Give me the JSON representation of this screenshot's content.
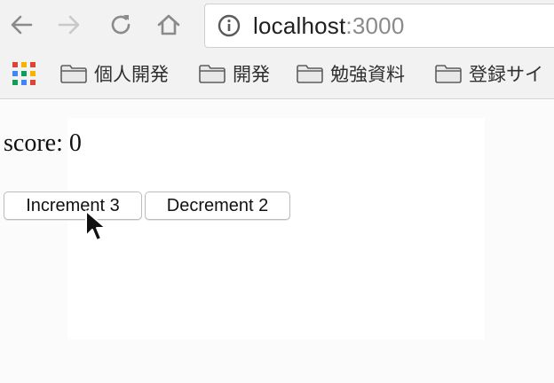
{
  "browser": {
    "address": {
      "host": "localhost",
      "port": ":3000"
    },
    "bookmarks": [
      {
        "label": "個人開発"
      },
      {
        "label": "開発"
      },
      {
        "label": "勉強資料"
      },
      {
        "label": "登録サイ"
      }
    ]
  },
  "page": {
    "score_label": "score: 0",
    "increment_label": "Increment 3",
    "decrement_label": "Decrement 2"
  },
  "icons": {
    "back": "back-arrow-icon",
    "forward": "forward-arrow-icon",
    "reload": "reload-icon",
    "home": "home-icon",
    "info": "info-icon",
    "apps": "apps-grid-icon",
    "folder": "folder-icon",
    "cursor": "mouse-pointer-icon"
  },
  "colors": {
    "chrome_bg": "#f2f2f2",
    "port_text": "#8a8a8a",
    "apps": [
      "#db4437",
      "#f4b400",
      "#0f9d58",
      "#4285f4"
    ]
  }
}
